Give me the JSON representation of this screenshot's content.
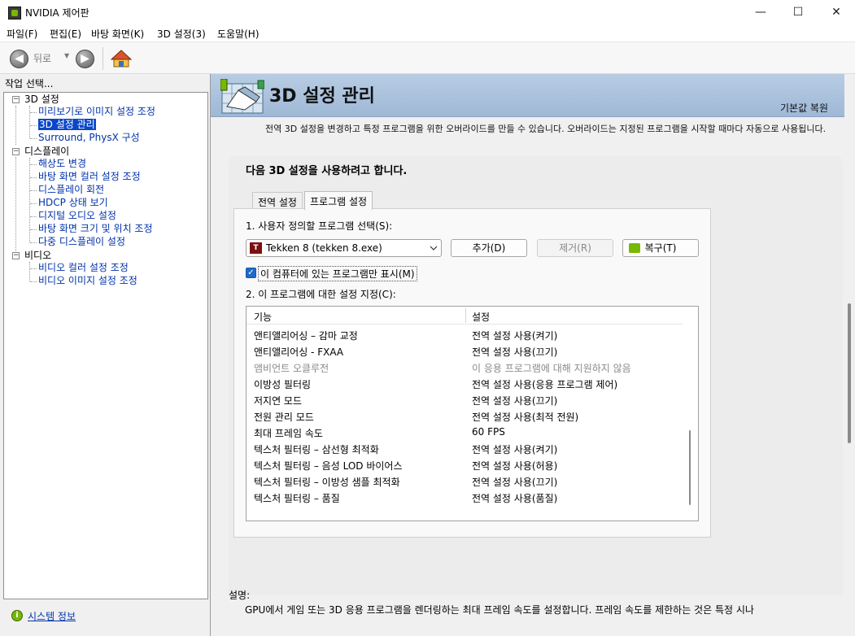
{
  "window": {
    "title": "NVIDIA 제어판",
    "minimize": "—",
    "maximize": "☐",
    "close": "✕"
  },
  "menu": [
    "파일(F)",
    "편집(E)",
    "바탕 화면(K)",
    "3D 설정(3)",
    "도움말(H)"
  ],
  "toolbar": {
    "back_label": "뒤로",
    "back_dropdown": "▼",
    "back_icon": "arrow-left-icon",
    "forward_icon": "arrow-right-icon",
    "home_icon": "home-icon"
  },
  "sidebar": {
    "header": "작업 선택...",
    "groups": [
      {
        "label": "3D 설정",
        "items": [
          "미리보기로 이미지 설정 조정",
          "3D 설정 관리",
          "Surround, PhysX 구성"
        ]
      },
      {
        "label": "디스플레이",
        "items": [
          "해상도 변경",
          "바탕 화면 컬러 설정 조정",
          "디스플레이 회전",
          "HDCP 상태 보기",
          "디지털 오디오 설정",
          "바탕 화면 크기 및 위치 조정",
          "다중 디스플레이 설정"
        ]
      },
      {
        "label": "비디오",
        "items": [
          "비디오 컬러 설정 조정",
          "비디오 이미지 설정 조정"
        ]
      }
    ],
    "selected": "3D 설정 관리",
    "toggle": "−",
    "system_info": "시스템 정보",
    "system_info_icon": "i"
  },
  "header": {
    "title": "3D 설정 관리",
    "restore": "기본값 복원"
  },
  "description": "전역 3D 설정을 변경하고 특정 프로그램을 위한 오버라이드를 만들 수 있습니다. 오버라이드는 지정된 프로그램을 시작할 때마다 자동으로 사용됩니다.",
  "panel": {
    "title": "다음 3D 설정을 사용하려고 합니다.",
    "tabs": [
      "전역 설정",
      "프로그램 설정"
    ],
    "active_tab": "프로그램 설정",
    "step1_label": "1. 사용자 정의할 프로그램 선택(S):",
    "program_select": "Tekken 8 (tekken 8.exe)",
    "program_icon": "T",
    "add_button": "추가(D)",
    "remove_button": "제거(R)",
    "restore_button": "복구(T)",
    "show_only_checkbox": "이 컴퓨터에 있는 프로그램만 표시(M)",
    "show_only_checked": true,
    "checkmark": "✓",
    "step2_label": "2. 이 프로그램에 대한 설정 지정(C):",
    "grid": {
      "columns": [
        "기능",
        "설정"
      ],
      "rows": [
        {
          "feature": "앤티앨리어싱 – 감마 교정",
          "setting": "전역 설정 사용(켜기)",
          "disabled": false
        },
        {
          "feature": "앤티앨리어싱 - FXAA",
          "setting": "전역 설정 사용(끄기)",
          "disabled": false
        },
        {
          "feature": "앰비언트 오클루전",
          "setting": "이 응용 프로그램에 대해 지원하지 않음",
          "disabled": true
        },
        {
          "feature": "이방성 필터링",
          "setting": "전역 설정 사용(응용 프로그램 제어)",
          "disabled": false
        },
        {
          "feature": "저지연 모드",
          "setting": "전역 설정 사용(끄기)",
          "disabled": false
        },
        {
          "feature": "전원 관리 모드",
          "setting": "전역 설정 사용(최적 전원)",
          "disabled": false
        },
        {
          "feature": "최대 프레임 속도",
          "setting": "60 FPS",
          "disabled": false
        },
        {
          "feature": "텍스처 필터링 – 삼선형 최적화",
          "setting": "전역 설정 사용(켜기)",
          "disabled": false
        },
        {
          "feature": "텍스처 필터링 – 음성 LOD 바이어스",
          "setting": "전역 설정 사용(허용)",
          "disabled": false
        },
        {
          "feature": "텍스처 필터링 – 이방성 샘플 최적화",
          "setting": "전역 설정 사용(끄기)",
          "disabled": false
        },
        {
          "feature": "텍스처 필터링 – 품질",
          "setting": "전역 설정 사용(품질)",
          "disabled": false
        }
      ]
    }
  },
  "footer": {
    "description_label": "설명:",
    "description_text": "GPU에서 게임 또는 3D 응용 프로그램을 렌더링하는 최대 프레임 속도를 설정합니다. 프레임 속도를 제한하는 것은 특정 시나"
  },
  "colors": {
    "nvidia_green": "#76b900",
    "selection_blue": "#0a46c8",
    "link_blue": "#0033aa",
    "header_band": "#b8cde4"
  }
}
